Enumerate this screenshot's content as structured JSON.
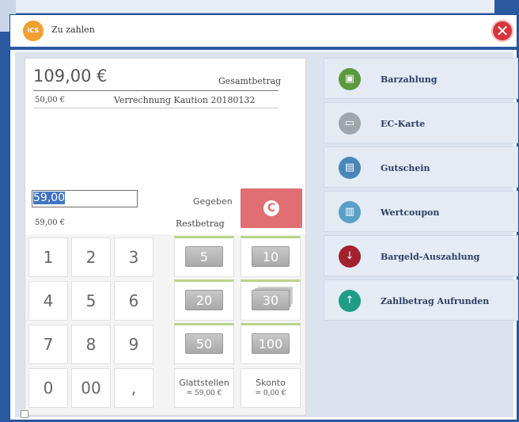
{
  "dialog": {
    "title": "Zu zahlen",
    "logo_text": "iCS",
    "close_glyph": "✕"
  },
  "summary": {
    "total_amount": "109,00 €",
    "total_label": "Gesamtbetrag",
    "deposit_amount": "50,00 €",
    "deposit_label": "Verrechnung Kaution 20180132",
    "given_value": "59,00",
    "given_label": "Gegeben",
    "rest_amount": "59,00 €",
    "rest_label": "Restbetrag",
    "clear_label": "C"
  },
  "keypad": {
    "keys": [
      "1",
      "2",
      "3",
      "4",
      "5",
      "6",
      "7",
      "8",
      "9",
      "0",
      "00",
      ","
    ]
  },
  "bills": [
    "5",
    "10",
    "20",
    "30",
    "50",
    "100"
  ],
  "functions": {
    "glattstellen_label": "Glattstellen",
    "glattstellen_value": "= 59,00 €",
    "skonto_label": "Skonto",
    "skonto_value": "= 0,00 €"
  },
  "payment_methods": [
    {
      "label": "Barzahlung",
      "icon": "cash-register-icon",
      "color": "#5a9a3c"
    },
    {
      "label": "EC-Karte",
      "icon": "card-icon",
      "color": "#9fa6ae"
    },
    {
      "label": "Gutschein",
      "icon": "voucher-icon",
      "color": "#4a87b8"
    },
    {
      "label": "Wertcoupon",
      "icon": "coupon-icon",
      "color": "#5aa0c8"
    },
    {
      "label": "Bargeld-Auszahlung",
      "icon": "cash-payout-icon",
      "color": "#a3202e"
    },
    {
      "label": "Zahlbetrag Aufrunden",
      "icon": "round-up-icon",
      "color": "#1e9c86"
    }
  ],
  "colors": {
    "accent": "#2c5aa0",
    "clear_button": "#e06e73",
    "close_button": "#d8343c"
  }
}
